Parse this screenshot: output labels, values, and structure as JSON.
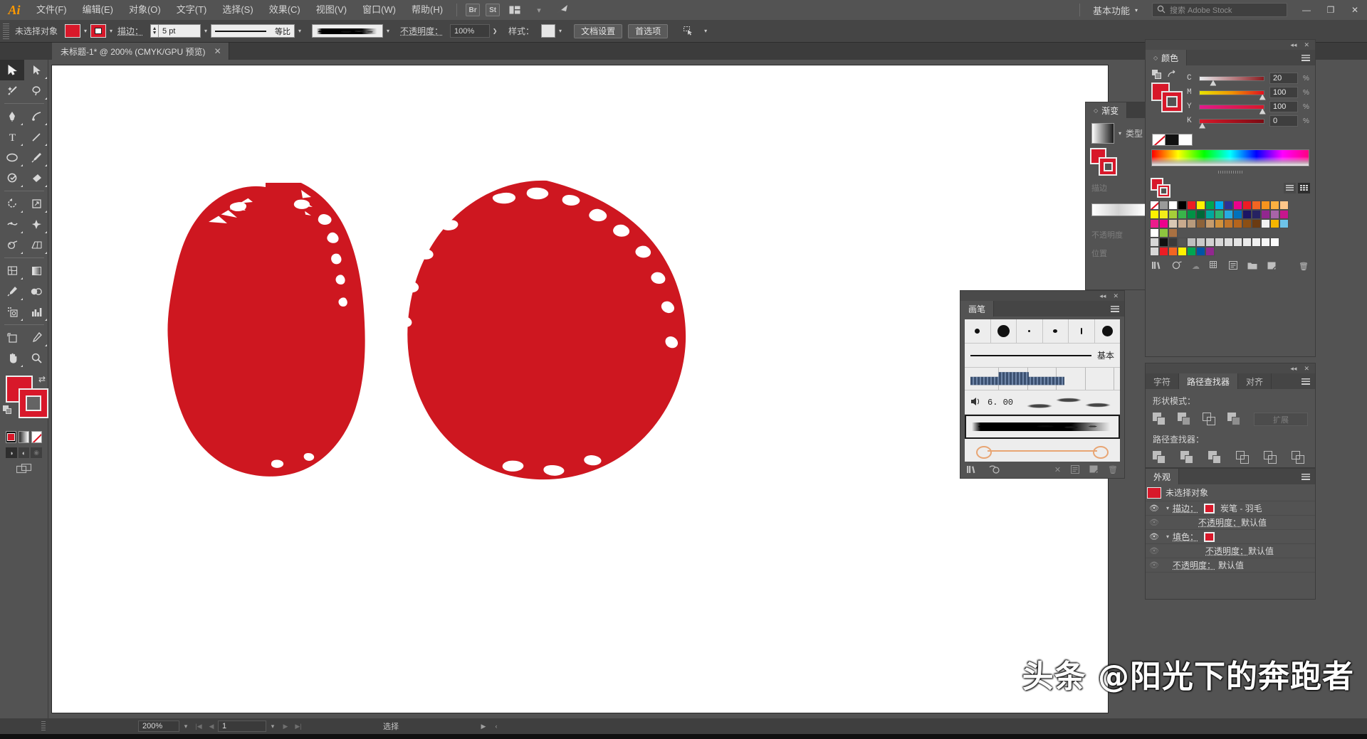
{
  "app": {
    "name": "Adobe Illustrator",
    "logo": "Ai"
  },
  "menubar": {
    "items": [
      {
        "label": "文件(F)"
      },
      {
        "label": "编辑(E)"
      },
      {
        "label": "对象(O)"
      },
      {
        "label": "文字(T)"
      },
      {
        "label": "选择(S)"
      },
      {
        "label": "效果(C)"
      },
      {
        "label": "视图(V)"
      },
      {
        "label": "窗口(W)"
      },
      {
        "label": "帮助(H)"
      }
    ],
    "bridge_icon": "Br",
    "stock_icon": "St",
    "arrange_icon": "arrange-documents-icon",
    "workspace": "基本功能",
    "search_placeholder": "搜索 Adobe Stock",
    "win_min": "—",
    "win_max": "❐",
    "win_close": "✕"
  },
  "controlbar": {
    "selection_label": "未选择对象",
    "stroke_label": "描边：",
    "stroke_width": "5 pt",
    "profile_label": "等比",
    "opacity_label": "不透明度：",
    "opacity_value": "100%",
    "style_label": "样式：",
    "doc_setup": "文档设置",
    "preferences": "首选项"
  },
  "tab": {
    "title": "未标题-1* @ 200% (CMYK/GPU 预览)",
    "close": "✕"
  },
  "toolbar": {
    "tools": [
      {
        "name": "selection-tool",
        "glyph": "⬈",
        "active": true
      },
      {
        "name": "direct-selection-tool",
        "glyph": "⬀",
        "active": false
      },
      {
        "name": "magic-wand-tool",
        "glyph": "✨",
        "active": false
      },
      {
        "name": "lasso-tool",
        "glyph": "🖇",
        "active": false
      },
      {
        "name": "pen-tool",
        "glyph": "✒",
        "active": false
      },
      {
        "name": "curvature-tool",
        "glyph": "✎",
        "active": false
      },
      {
        "name": "type-tool",
        "glyph": "T",
        "active": false
      },
      {
        "name": "line-segment-tool",
        "glyph": "╱",
        "active": false
      },
      {
        "name": "ellipse-tool",
        "glyph": "◯",
        "active": false
      },
      {
        "name": "paintbrush-tool",
        "glyph": "🖌",
        "active": false
      },
      {
        "name": "shaper-tool",
        "glyph": "◔",
        "active": false
      },
      {
        "name": "eraser-tool",
        "glyph": "◆",
        "active": false
      },
      {
        "name": "rotate-tool",
        "glyph": "↺",
        "active": false
      },
      {
        "name": "scale-tool",
        "glyph": "⤢",
        "active": false
      },
      {
        "name": "width-tool",
        "glyph": "✂",
        "active": false
      },
      {
        "name": "free-transform-tool",
        "glyph": "✛",
        "active": false
      },
      {
        "name": "shape-builder-tool",
        "glyph": "⊙",
        "active": false
      },
      {
        "name": "perspective-grid-tool",
        "glyph": "◫",
        "active": false
      },
      {
        "name": "mesh-tool",
        "glyph": "▦",
        "active": false
      },
      {
        "name": "gradient-tool",
        "glyph": "▧",
        "active": false
      },
      {
        "name": "eyedropper-tool",
        "glyph": "✐",
        "active": false
      },
      {
        "name": "blend-tool",
        "glyph": "◑",
        "active": false
      },
      {
        "name": "symbol-sprayer-tool",
        "glyph": "⁘",
        "active": false
      },
      {
        "name": "column-graph-tool",
        "glyph": "▊",
        "active": false
      },
      {
        "name": "artboard-tool",
        "glyph": "⬓",
        "active": false
      },
      {
        "name": "slice-tool",
        "glyph": "✎",
        "active": false
      },
      {
        "name": "hand-tool",
        "glyph": "✋",
        "active": false
      },
      {
        "name": "zoom-tool",
        "glyph": "🔍",
        "active": false
      }
    ],
    "fill_color": "#d8182a",
    "stroke_color": "#d8182a",
    "swap_icon": "⇄",
    "draw_modes": [
      "draw-normal",
      "draw-behind",
      "draw-inside"
    ]
  },
  "canvas": {
    "shape_color": "#ce1720",
    "shape_left_name": "red-ink-oval-left",
    "shape_right_name": "red-ink-circle-right"
  },
  "panels": {
    "color": {
      "title": "颜色",
      "channels": [
        {
          "label": "C",
          "value": "20",
          "unit": "%",
          "pos": 18
        },
        {
          "label": "M",
          "value": "100",
          "unit": "%",
          "pos": 97
        },
        {
          "label": "Y",
          "value": "100",
          "unit": "%",
          "pos": 97
        },
        {
          "label": "K",
          "value": "0",
          "unit": "%",
          "pos": 1
        }
      ],
      "none_swatch": "none-swatch",
      "black_swatch": "black-swatch",
      "white_swatch": "white-swatch"
    },
    "gradient": {
      "title": "渐变",
      "type_label": "类型",
      "stroke_label": "描边",
      "opacity_label": "不透明度",
      "location_label": "位置"
    },
    "swatches": {
      "rows": [
        [
          "#ffffff",
          "#9a9a9a",
          "#ffffff",
          "#000000",
          "#ed1c24",
          "#fff200",
          "#00a651",
          "#00aeef",
          "#2e3192",
          "#ec008c",
          "#ed1c24",
          "#f26522",
          "#f7941e",
          "#fbb040",
          "#fdc689"
        ],
        [
          "#fff200",
          "#f3ec19",
          "#a6ce39",
          "#39b54a",
          "#009245",
          "#006837",
          "#00a99d",
          "#2bb673",
          "#27aae1",
          "#0071bc",
          "#1b1464",
          "#262262",
          "#92278f",
          "#a864a8",
          "#c6168d"
        ],
        [
          "#ec1c8c",
          "#ec008c",
          "#d9c8b4",
          "#c9ab8e",
          "#b89b7c",
          "#8c6239",
          "#c69c6d",
          "#d1913c",
          "#c1752a",
          "#b5651d",
          "#8c4f14",
          "#6b3b12",
          "#f2f2f2",
          "#f7b500",
          "#6ec3e8"
        ],
        [
          "#ffffff",
          "#8dc63f",
          "#a97142"
        ],
        [
          "#d8d8d8",
          "#111111",
          "#3a3a3a",
          "#555555",
          "#bfbfbf",
          "#c9c9c9",
          "#d2d2d2",
          "#d8d8d8",
          "#dedede",
          "#e4e4e4",
          "#eaeaea",
          "#f0f0f0",
          "#f6f6f6",
          "#fcfcfc"
        ],
        [
          "#d8d8d8",
          "#ed1c24",
          "#f26522",
          "#fff200",
          "#00a651",
          "#0054a6",
          "#92278f"
        ]
      ]
    },
    "brushes": {
      "title": "画笔",
      "basic_label": "基本",
      "bristle_size": "6. 00",
      "rows": [
        "brush-dot-row",
        "basic-brush",
        "art-pattern-brush",
        "bristle-brush",
        "charcoal-feather-brush",
        "arrow-art-brush"
      ]
    },
    "pathfinder": {
      "tabs": [
        {
          "label": "字符",
          "active": false
        },
        {
          "label": "路径查找器",
          "active": true
        },
        {
          "label": "对齐",
          "active": false
        }
      ],
      "shape_modes_label": "形状模式：",
      "pathfinder_label": "路径查找器：",
      "expand_label": "扩展"
    },
    "appearance": {
      "title": "外观",
      "target": "未选择对象",
      "rows": [
        {
          "label": "描边：",
          "value": "炭笔 - 羽毛",
          "type": "stroke"
        },
        {
          "label": "不透明度：",
          "value": "默认值",
          "type": "sub"
        },
        {
          "label": "填色：",
          "value": "",
          "type": "fill"
        },
        {
          "label": "不透明度：",
          "value": "默认值",
          "type": "sub"
        },
        {
          "label": "不透明度：",
          "value": "默认值",
          "type": "root"
        }
      ]
    }
  },
  "statusbar": {
    "zoom": "200%",
    "page": "1",
    "tool_name": "选择"
  },
  "watermark": "头条 @阳光下的奔跑者"
}
